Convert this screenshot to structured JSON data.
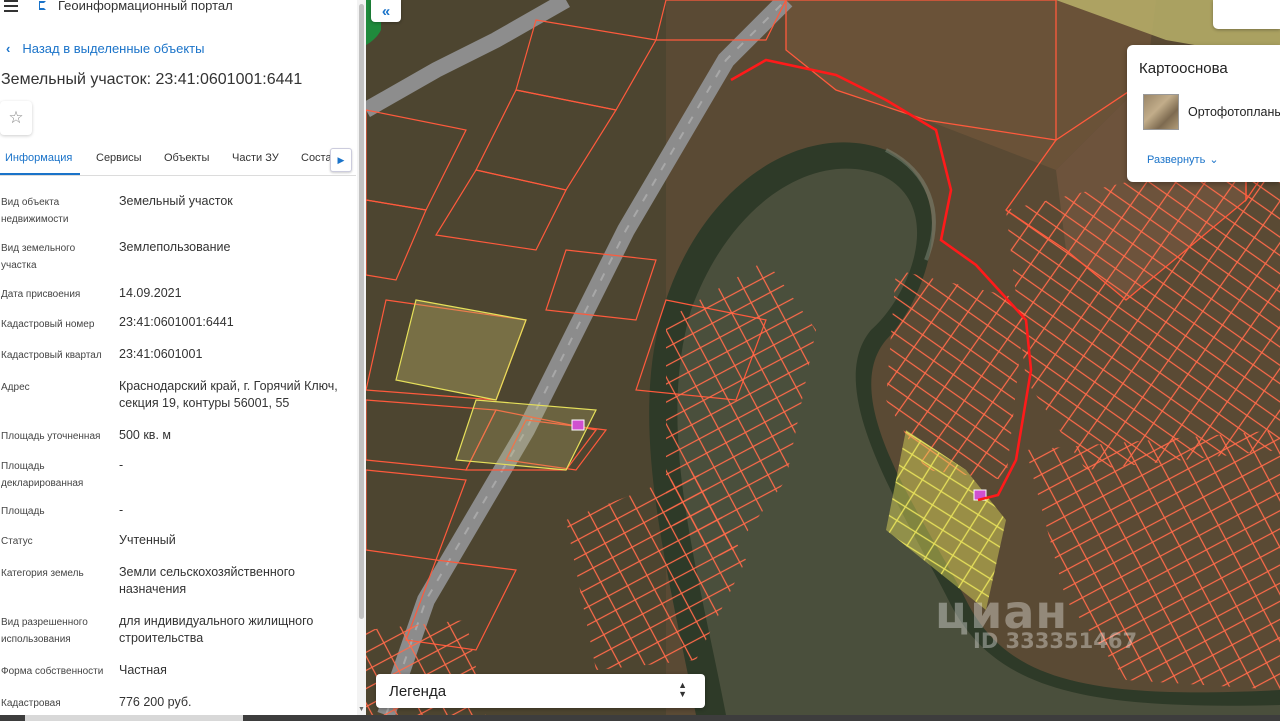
{
  "app": {
    "title": "Геоинформационный портал"
  },
  "nav": {
    "back_label": "Назад в выделенные объекты"
  },
  "object": {
    "title": "Земельный участок: 23:41:0601001:6441"
  },
  "tabs": [
    {
      "label": "Информация",
      "active": true
    },
    {
      "label": "Сервисы",
      "active": false
    },
    {
      "label": "Объекты",
      "active": false
    },
    {
      "label": "Части ЗУ",
      "active": false
    },
    {
      "label": "Соста",
      "active": false
    }
  ],
  "attributes": [
    {
      "label": "Вид объекта недвижимости",
      "value": "Земельный участок"
    },
    {
      "label": "Вид земельного участка",
      "value": "Землепользование"
    },
    {
      "label": "Дата присвоения",
      "value": "14.09.2021"
    },
    {
      "label": "Кадастровый номер",
      "value": "23:41:0601001:6441"
    },
    {
      "label": "Кадастровый квартал",
      "value": "23:41:0601001"
    },
    {
      "label": "Адрес",
      "value": "Краснодарский край, г. Горячий Ключ, секция 19, контуры 56001, 55"
    },
    {
      "label": "Площадь уточненная",
      "value": "500 кв. м"
    },
    {
      "label": "Площадь декларированная",
      "value": "-"
    },
    {
      "label": "Площадь",
      "value": "-"
    },
    {
      "label": "Статус",
      "value": "Учтенный"
    },
    {
      "label": "Категория земель",
      "value": "Земли сельскохозяйственного назначения"
    },
    {
      "label": "Вид разрешенного использования",
      "value": "для индивидуального жилищного строительства"
    },
    {
      "label": "Форма собственности",
      "value": "Частная"
    },
    {
      "label": "Кадастровая",
      "value": "776 200 руб."
    }
  ],
  "basemap": {
    "title": "Картооснова",
    "selected": "Ортофотопланы",
    "expand_label": "Развернуть"
  },
  "legend": {
    "label": "Легенда"
  },
  "watermark": {
    "brand": "циан",
    "id": "ID 333351467"
  },
  "icons": {
    "menu": "hamburger-icon",
    "logo": "portal-logo-icon",
    "back": "chevron-left-icon",
    "favorite": "star-icon",
    "tab_scroll": "chevron-right-icon",
    "collapse": "double-chevron-left-icon",
    "expand": "chevron-down-icon",
    "legend_toggle": "sort-arrows-icon"
  },
  "colors": {
    "accent": "#1a73c9",
    "parcel_outline": "#ff5a3c",
    "selected_outline": "#ff1a1a",
    "highlight_fill": "#e6e05a"
  }
}
